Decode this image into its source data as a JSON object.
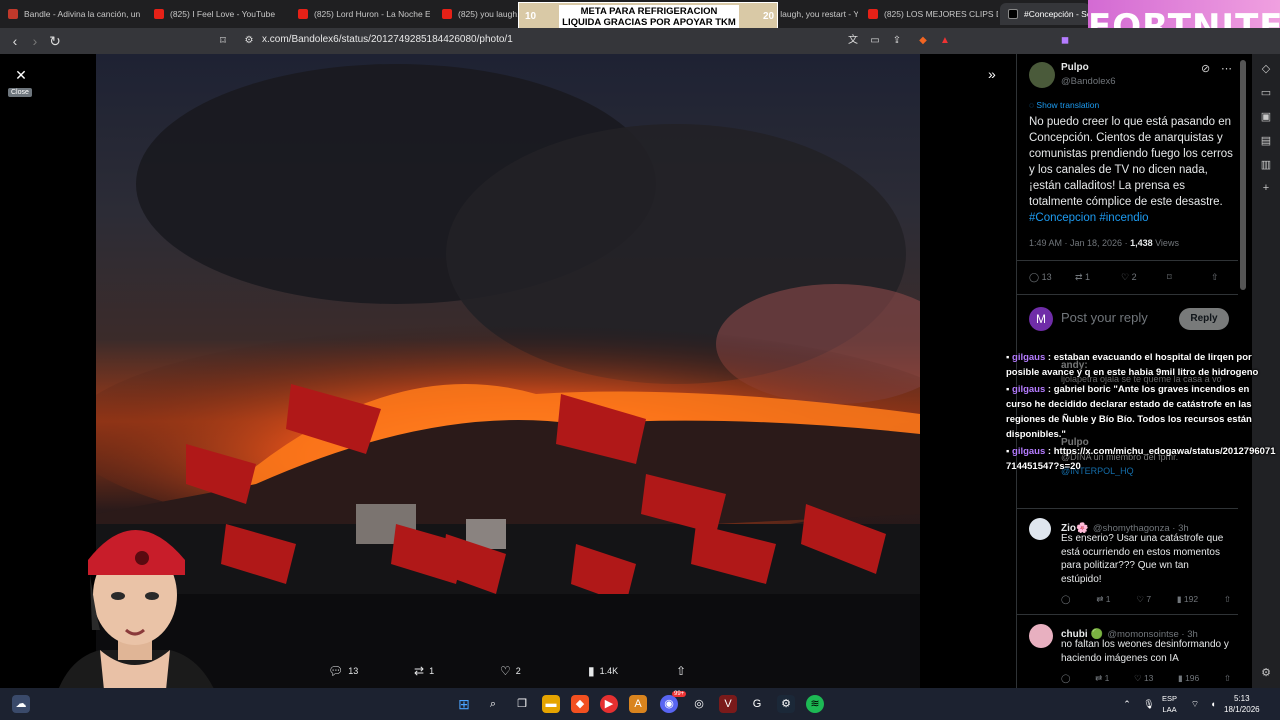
{
  "tabs": [
    {
      "label": "Bandle - Adivina la canción, un",
      "favicon": "bandle-icon"
    },
    {
      "label": "(825) I Feel Love - YouTube",
      "favicon": "youtube-icon"
    },
    {
      "label": "(825) Lord Huron - La Noche E",
      "favicon": "youtube-icon"
    },
    {
      "label": "(825) you laugh, yo",
      "favicon": "youtube-icon"
    },
    {
      "label": "(825) you laugh, you restart - Y",
      "favicon": "youtube-icon"
    },
    {
      "label": "(825) LOS MEJORES CLIPS DE",
      "favicon": "youtube-icon"
    },
    {
      "label": "#Concepción - Sea",
      "favicon": "x-icon"
    }
  ],
  "address_bar": {
    "url": "x.com/Bandolex6/status/2012749285184426080/photo/1"
  },
  "banner": {
    "left_num": "10",
    "right_num": "20",
    "line1": "META PARA REFRIGERACION",
    "line2": "LIQUIDA GRACIAS POR APOYAR TKM"
  },
  "fortnite": {
    "label": "FORTNITE"
  },
  "viewer": {
    "close_tooltip": "Close",
    "actions": {
      "replies": "13",
      "reposts": "1",
      "likes": "2",
      "views": "1.4K"
    }
  },
  "tweet": {
    "author_name": "Pulpo",
    "author_handle": "@Bandolex6",
    "show_translation": "Show translation",
    "text": "No puedo creer lo que está pasando en Concepción. Cientos de anarquistas y comunistas prendiendo fuego los cerros y los canales de TV no dicen nada, ¡están calladitos! La prensa es totalmente cómplice de este desastre.",
    "hashtag1": "#Concepcion",
    "hashtag2": "#incendio",
    "timestamp": "1:49 AM · Jan 18, 2026 · ",
    "views_count": "1,438",
    "views_label": " Views",
    "stats": {
      "replies": "13",
      "reposts": "1",
      "likes": "2"
    }
  },
  "reply_box": {
    "avatar_letter": "M",
    "placeholder": "Post your reply",
    "button": "Reply"
  },
  "hidden_replies": {
    "andy_name": "andy:",
    "andy_text": "ljolapetra ojala se te queme la casa a vo",
    "pulpo_name": "Pulpo",
    "pulpo_text": "@DINA un miembro del fpmr.",
    "interpol": "@INTERPOL_HQ"
  },
  "chat": [
    {
      "user": "gilgaus",
      "text": " : estaban evacuando el hospital de lirqen por posible avance y q en este habia 9mil litro de hidrogeno"
    },
    {
      "user": "gilgaus",
      "text": " : gabriel boric \"Ante los graves incendios en curso he decidido declarar estado de catástrofe en las regiones de Ñuble y Bío Bío. Todos los recursos están disponibles.\""
    },
    {
      "user": "gilgaus",
      "text": " : https://x.com/michu_edogawa/status/2012796071714451547?s=20"
    }
  ],
  "replies": [
    {
      "name": "Zio🌸",
      "handle": "@shomythagonza · 3h",
      "text": "Es enserio? Usar una catástrofe que está ocurriendo en estos momentos para politizar??? Que wn tan estúpido!",
      "reposts": "1",
      "likes": "7",
      "views": "192"
    },
    {
      "name": "chubi 🟢",
      "handle": "@momonsointse · 3h",
      "text": "no faltan los weones desinformando y haciendo imágenes con IA",
      "reposts": "1",
      "likes": "13",
      "views": "196"
    }
  ],
  "taskbar": {
    "lang1": "ESP",
    "lang2": "LAA",
    "time": "5:13",
    "date": "18/1/2026",
    "badge": "99+"
  },
  "colors": {
    "accent": "#1d9bf0",
    "chat_user": "#b57cff",
    "taskbar": "#1c2230"
  }
}
